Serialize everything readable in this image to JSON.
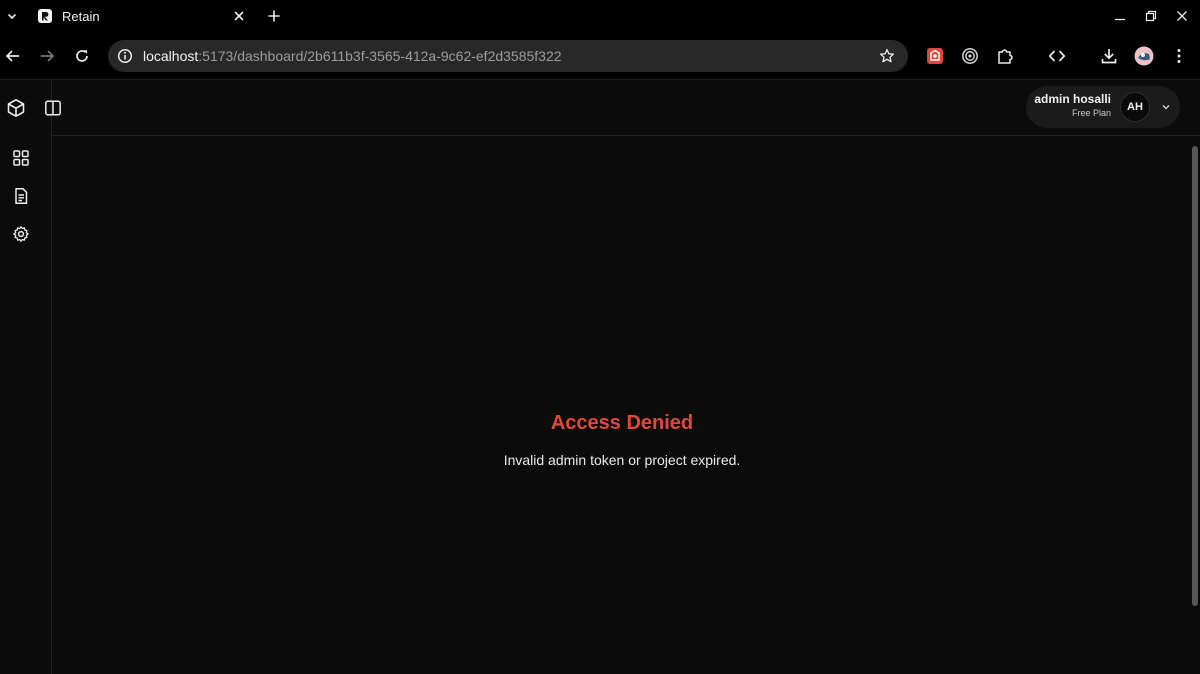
{
  "browser": {
    "tab": {
      "title": "Retain"
    },
    "address": {
      "host": "localhost",
      "path": ":5173/dashboard/2b611b3f-3565-412a-9c62-ef2d3585f322"
    },
    "icons": {
      "tab_list": "chevron-down-icon",
      "tab_close": "close-icon",
      "new_tab": "plus-icon",
      "back": "arrow-left-icon",
      "forward": "arrow-right-icon",
      "reload": "reload-icon",
      "site_info": "info-icon",
      "bookmark": "star-icon",
      "downloads": "download-icon",
      "menu": "kebab-icon"
    }
  },
  "user": {
    "name": "admin hosalli",
    "plan": "Free Plan",
    "initials": "AH"
  },
  "error": {
    "title": "Access Denied",
    "message": "Invalid admin token or project expired."
  },
  "colors": {
    "background": "#0c0b0b",
    "error": "#e0493d",
    "chip": "#1c1b1b"
  }
}
